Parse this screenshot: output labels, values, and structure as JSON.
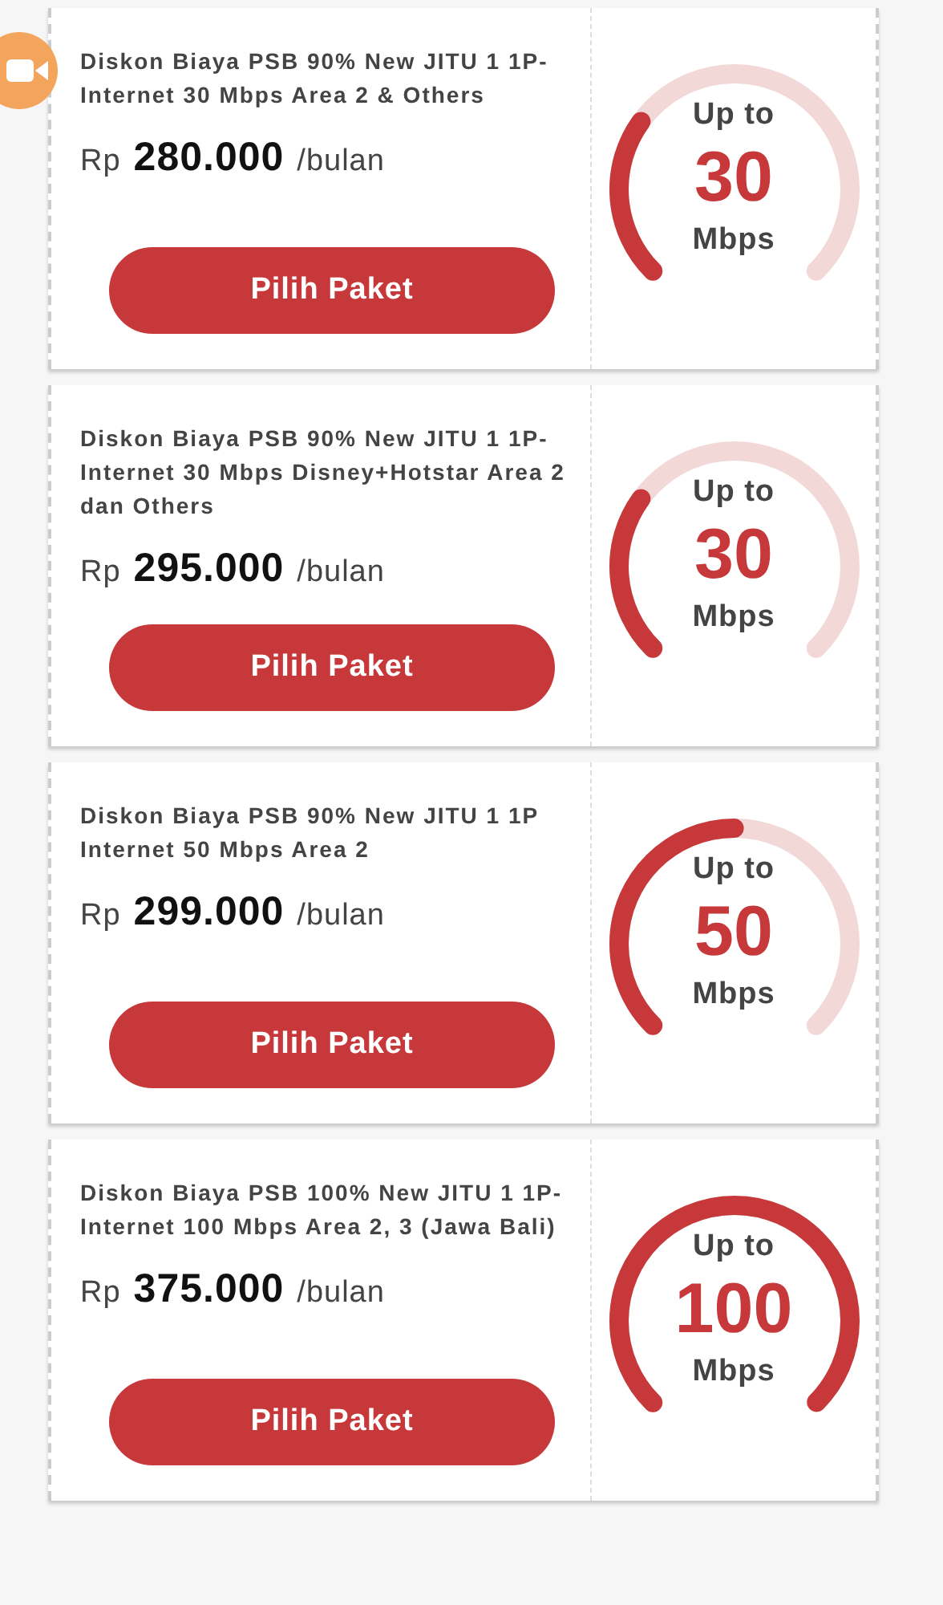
{
  "packages": [
    {
      "title": "Diskon Biaya PSB 90% New JITU 1 1P-Internet 30 Mbps Area 2 & Others",
      "currency": "Rp",
      "price": "280.000",
      "period": "/bulan",
      "button": "Pilih Paket",
      "speed_label": "Up to",
      "speed": "30",
      "unit": "Mbps"
    },
    {
      "title": "Diskon Biaya PSB 90% New JITU 1 1P-Internet 30 Mbps Disney+Hotstar Area 2 dan Others",
      "currency": "Rp",
      "price": "295.000",
      "period": "/bulan",
      "button": "Pilih Paket",
      "speed_label": "Up to",
      "speed": "30",
      "unit": "Mbps"
    },
    {
      "title": "Diskon Biaya PSB 90% New JITU 1 1P Internet 50 Mbps Area 2",
      "currency": "Rp",
      "price": "299.000",
      "period": "/bulan",
      "button": "Pilih Paket",
      "speed_label": "Up to",
      "speed": "50",
      "unit": "Mbps"
    },
    {
      "title": "Diskon Biaya PSB 100% New JITU 1 1P-Internet 100 Mbps Area 2, 3 (Jawa Bali)",
      "currency": "Rp",
      "price": "375.000",
      "period": "/bulan",
      "button": "Pilih Paket",
      "speed_label": "Up to",
      "speed": "100",
      "unit": "Mbps"
    }
  ]
}
